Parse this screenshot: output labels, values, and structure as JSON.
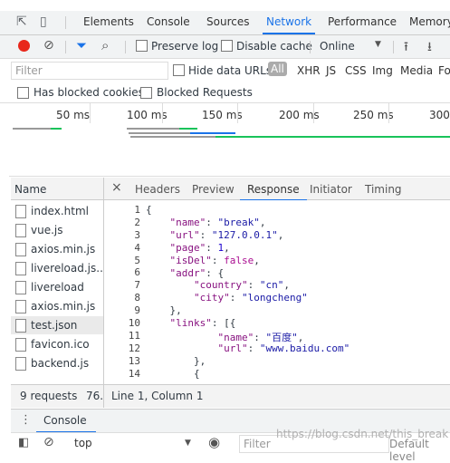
{
  "tabs": [
    "Elements",
    "Console",
    "Sources",
    "Network",
    "Performance",
    "Memory"
  ],
  "toolbar": {
    "preserve_log": "Preserve log",
    "disable_cache": "Disable cache",
    "throttle": "Online"
  },
  "filterbar": {
    "placeholder": "Filter",
    "hide_data_urls": "Hide data URLs",
    "all": "All",
    "types": [
      "XHR",
      "JS",
      "CSS",
      "Img",
      "Media",
      "Fo"
    ]
  },
  "blocked": {
    "has_blocked_cookies": "Has blocked cookies",
    "blocked_requests": "Blocked Requests"
  },
  "timeline": {
    "ticks": [
      "50 ms",
      "100 ms",
      "150 ms",
      "200 ms",
      "250 ms",
      "300"
    ]
  },
  "files": {
    "header": "Name",
    "items": [
      "index.html",
      "vue.js",
      "axios.min.js",
      "livereload.js...",
      "livereload",
      "axios.min.js",
      "test.json",
      "favicon.ico",
      "backend.js"
    ]
  },
  "detail_tabs": [
    "Headers",
    "Preview",
    "Response",
    "Initiator",
    "Timing"
  ],
  "code_lines": [
    "{",
    "    \"name\": \"break\",",
    "    \"url\": \"127.0.0.1\",",
    "    \"page\": 1,",
    "    \"isDel\": false,",
    "    \"addr\": {",
    "        \"country\": \"cn\",",
    "        \"city\": \"longcheng\"",
    "    },",
    "    \"links\": [{",
    "            \"name\": \"百度\",",
    "            \"url\": \"www.baidu.com\"",
    "        },",
    "        {"
  ],
  "status": {
    "requests": "9 requests",
    "size": "76.",
    "cursor": "Line 1, Column 1"
  },
  "drawer": {
    "tab": "Console"
  },
  "console": {
    "context": "top",
    "filter_placeholder": "Filter",
    "levels": "Default level"
  },
  "watermark": "https://blog.csdn.net/this_break",
  "colors": {
    "accent": "#1a73e8",
    "record": "#e8271b"
  }
}
